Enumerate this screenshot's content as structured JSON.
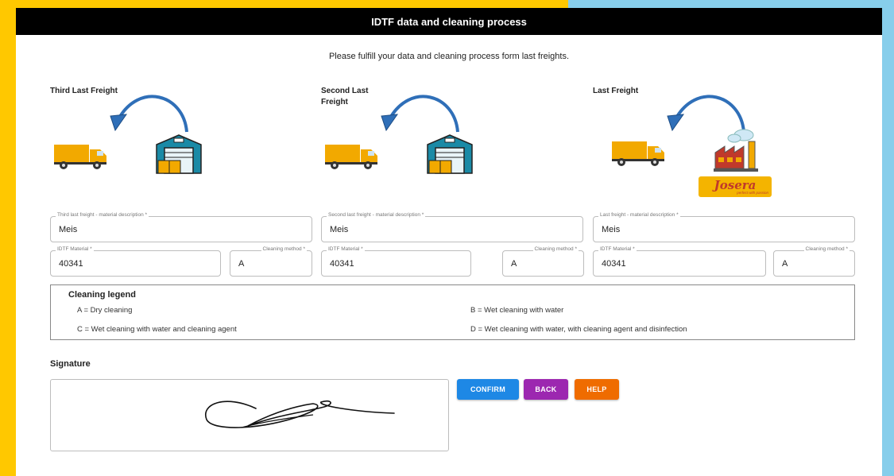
{
  "header": {
    "title": "IDTF data and cleaning process"
  },
  "instructions": "Please fulfill your data and cleaning process form last freights.",
  "columns": [
    {
      "title": "Third Last Freight",
      "material_label": "Third last freight - material description *",
      "material_value": "Meis",
      "idtf_label": "IDTF Material *",
      "idtf_value": "40341",
      "cleaning_label": "Cleaning method *",
      "cleaning_value": "A",
      "building": "warehouse-icon"
    },
    {
      "title": "Second Last Freight",
      "material_label": "Second last freight - material description *",
      "material_value": "Meis",
      "idtf_label": "IDTF Material *",
      "idtf_value": "40341",
      "cleaning_label": "Cleaning method *",
      "cleaning_value": "A",
      "building": "warehouse-icon"
    },
    {
      "title": "Last Freight",
      "material_label": "Last freight - material description *",
      "material_value": "Meis",
      "idtf_label": "IDTF Material *",
      "idtf_value": "40341",
      "cleaning_label": "Cleaning method *",
      "cleaning_value": "A",
      "building": "factory-icon",
      "logo_text": "Josera",
      "logo_tagline": "perfect with passion"
    }
  ],
  "legend": {
    "title": "Cleaning legend",
    "items": [
      "A = Dry cleaning",
      "B = Wet cleaning with water",
      "C = Wet cleaning with water and cleaning agent",
      "D = Wet cleaning with water, with cleaning agent and disinfection"
    ]
  },
  "signature": {
    "label": "Signature"
  },
  "buttons": {
    "confirm": "CONFIRM",
    "back": "BACK",
    "help": "HELP"
  },
  "colors": {
    "confirm": "#1E88E5",
    "back": "#9C27B0",
    "help": "#EF6C00",
    "arrow": "#2F6FB8",
    "truck": "#F2A900"
  }
}
